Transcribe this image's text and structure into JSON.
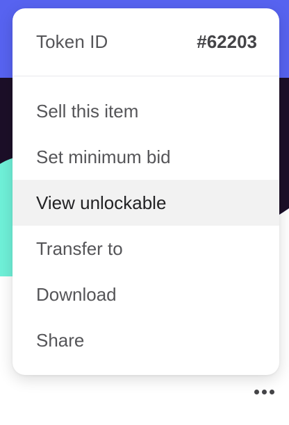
{
  "menu": {
    "header": {
      "label": "Token ID",
      "value": "#62203"
    },
    "items": [
      {
        "label": "Sell this item",
        "active": false
      },
      {
        "label": "Set minimum bid",
        "active": false
      },
      {
        "label": "View unlockable",
        "active": true
      },
      {
        "label": "Transfer to",
        "active": false
      },
      {
        "label": "Download",
        "active": false
      },
      {
        "label": "Share",
        "active": false
      }
    ]
  },
  "more_button": {
    "icon": "more-horizontal-icon"
  },
  "colors": {
    "artwork_blue": "#5763f0",
    "artwork_dark": "#1c0f28",
    "artwork_mint": "#6ff0d8",
    "active_row": "#f2f2f2"
  }
}
